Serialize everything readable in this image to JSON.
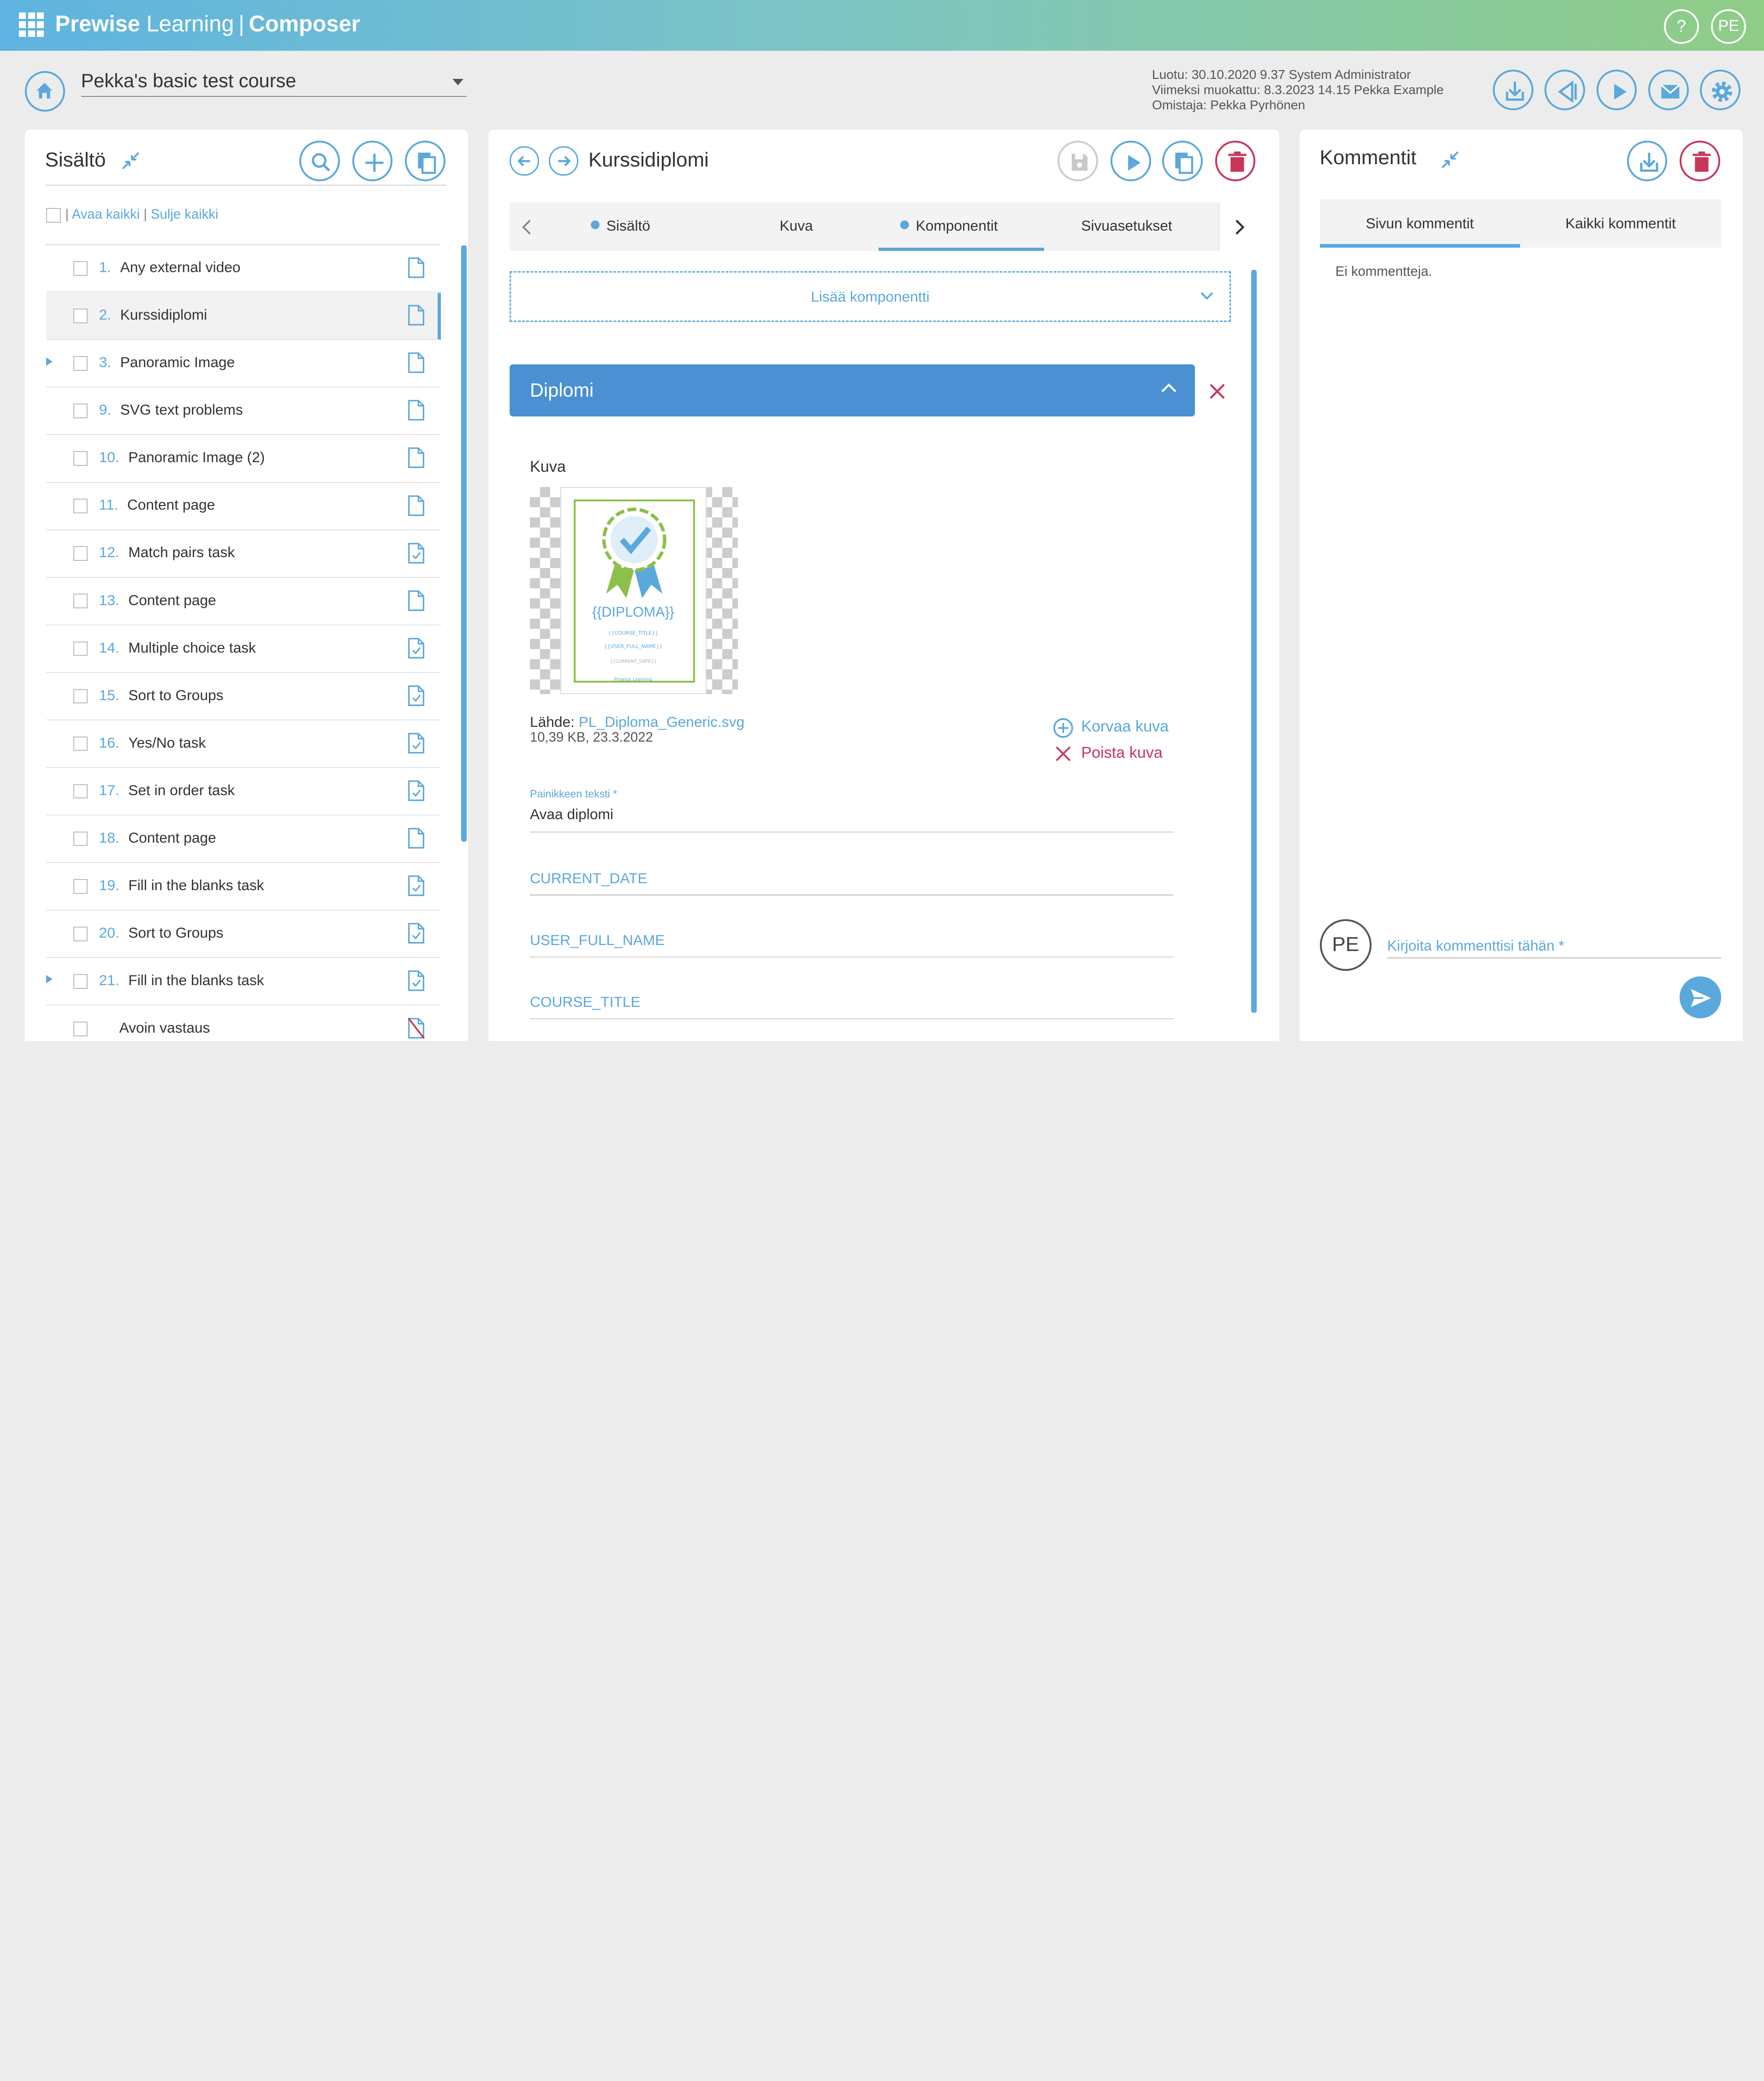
{
  "app": {
    "brand_name": "Prewise",
    "brand_product": "Learning",
    "brand_sep": "|",
    "brand_module": "Composer",
    "help_label": "?",
    "user_initials": "PE"
  },
  "course": {
    "title": "Pekka's basic test course"
  },
  "meta": {
    "created": "Luotu: 30.10.2020 9.37 System Administrator",
    "modified": "Viimeksi muokattu: 8.3.2023 14.15 Pekka Example",
    "owner": "Omistaja: Pekka Pyrhönen"
  },
  "left": {
    "title": "Sisältö",
    "open_all": "Avaa kaikki",
    "close_all": "Sulje kaikki",
    "items": [
      {
        "num": "1.",
        "label": "Any external video",
        "icon": "doc"
      },
      {
        "num": "2.",
        "label": "Kurssidiplomi",
        "icon": "doc"
      },
      {
        "num": "3.",
        "label": "Panoramic Image",
        "icon": "doc"
      },
      {
        "num": "9.",
        "label": "SVG text problems",
        "icon": "doc"
      },
      {
        "num": "10.",
        "label": "Panoramic Image (2)",
        "icon": "doc"
      },
      {
        "num": "11.",
        "label": "Content page",
        "icon": "doc"
      },
      {
        "num": "12.",
        "label": "Match pairs task",
        "icon": "task"
      },
      {
        "num": "13.",
        "label": "Content page",
        "icon": "doc"
      },
      {
        "num": "14.",
        "label": "Multiple choice task",
        "icon": "task"
      },
      {
        "num": "15.",
        "label": "Sort to Groups",
        "icon": "task"
      },
      {
        "num": "16.",
        "label": "Yes/No task",
        "icon": "task"
      },
      {
        "num": "17.",
        "label": "Set in order task",
        "icon": "task"
      },
      {
        "num": "18.",
        "label": "Content page",
        "icon": "doc"
      },
      {
        "num": "19.",
        "label": "Fill in the blanks task",
        "icon": "task"
      },
      {
        "num": "20.",
        "label": "Sort to Groups",
        "icon": "task"
      },
      {
        "num": "21.",
        "label": "Fill in the blanks task",
        "icon": "task"
      },
      {
        "num": "",
        "label": "Avoin vastaus",
        "icon": "doc-crossed"
      }
    ]
  },
  "center": {
    "title": "Kurssidiplomi",
    "tabs": [
      "Sisältö",
      "Kuva",
      "Komponentit",
      "Sivuasetukset"
    ],
    "add_component": "Lisää komponentti",
    "section_title": "Diplomi",
    "image_label": "Kuva",
    "diploma_text": "{{DIPLOMA}}",
    "diploma_course": "{{COURSE_TITLE}}",
    "diploma_user": "{{USER_FULL_NAME}}",
    "diploma_date": "{{CURRENT_DATE}}",
    "diploma_logo": "Prewise Learning",
    "source_label": "Lähde:",
    "source_file": "PL_Diploma_Generic.svg",
    "source_info": "10,39 KB, 23.3.2022",
    "replace_image": "Korvaa kuva",
    "remove_image": "Poista kuva",
    "button_text_label": "Painikkeen teksti *",
    "button_text_value": "Avaa diplomi",
    "fields": [
      "CURRENT_DATE",
      "USER_FULL_NAME",
      "COURSE_TITLE"
    ]
  },
  "right": {
    "title": "Kommentit",
    "tabs": [
      "Sivun kommentit",
      "Kaikki kommentit"
    ],
    "empty": "Ei kommentteja.",
    "avatar": "PE",
    "placeholder": "Kirjoita kommenttisi tähän *"
  },
  "colors": {
    "accent": "#5aa8dc",
    "danger": "#c8365a",
    "header_blue": "#4a90d2"
  }
}
